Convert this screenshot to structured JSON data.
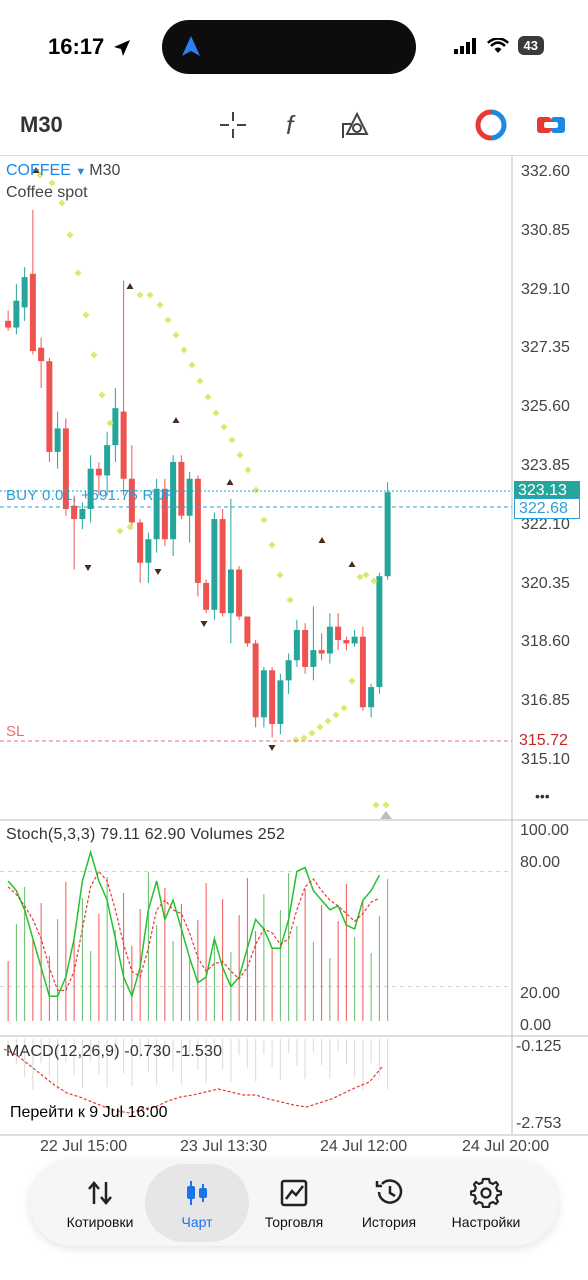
{
  "status": {
    "time": "16:17",
    "battery": "43"
  },
  "toolbar": {
    "timeframe": "M30"
  },
  "chart": {
    "symbol": "COFFEE",
    "timeframe": "M30",
    "description": "Coffee spot",
    "price_labels": [
      "332.60",
      "330.85",
      "329.10",
      "327.35",
      "325.60",
      "323.85",
      "322.10",
      "320.35",
      "318.60",
      "316.85",
      "315.10"
    ],
    "current_price": "323.13",
    "bid_price": "322.68",
    "sl_price": "315.72",
    "position_label": "BUY 0.01, +691.75 RUR",
    "sl_label": "SL",
    "more": "•••",
    "colors": {
      "bull": "#26a69a",
      "bear": "#ef5350",
      "psar": "#d7ec6b",
      "price_line": "#2a9fd6",
      "sl": "#e57373"
    }
  },
  "stoch": {
    "label": "Stoch(5,3,3) 79.11 62.90 Volumes 252",
    "levels": [
      "100.00",
      "80.00",
      "20.00",
      "0.00"
    ]
  },
  "macd": {
    "label": "MACD(12,26,9) -0.730 -1.530",
    "levels": [
      "-0.125",
      "-2.753"
    ]
  },
  "goto": "Перейти к 9 Jul 16:00",
  "x_labels": [
    "22 Jul 15:00",
    "23 Jul 13:30",
    "24 Jul 12:00",
    "24 Jul 20:00"
  ],
  "chart_data": {
    "type": "candlestick",
    "price_axis": [
      315.1,
      332.6
    ],
    "candles": [
      [
        328.2,
        328.5,
        327.9,
        328.0
      ],
      [
        328.0,
        329.3,
        327.8,
        328.8
      ],
      [
        328.6,
        329.8,
        328.2,
        329.5
      ],
      [
        329.6,
        331.5,
        327.2,
        327.3
      ],
      [
        327.4,
        327.7,
        326.2,
        327.0
      ],
      [
        327.0,
        327.1,
        324.0,
        324.3
      ],
      [
        324.3,
        325.5,
        323.8,
        325.0
      ],
      [
        325.0,
        325.3,
        322.4,
        322.6
      ],
      [
        322.7,
        323.0,
        320.8,
        322.3
      ],
      [
        322.3,
        322.8,
        322.0,
        322.6
      ],
      [
        322.6,
        324.2,
        322.2,
        323.8
      ],
      [
        323.8,
        324.0,
        323.0,
        323.6
      ],
      [
        323.6,
        324.9,
        323.0,
        324.5
      ],
      [
        324.5,
        326.2,
        324.0,
        325.6
      ],
      [
        325.5,
        329.4,
        323.0,
        323.5
      ],
      [
        323.5,
        324.5,
        322.0,
        322.2
      ],
      [
        322.2,
        322.3,
        320.4,
        321.0
      ],
      [
        321.0,
        321.9,
        320.4,
        321.7
      ],
      [
        321.7,
        323.5,
        321.3,
        323.2
      ],
      [
        323.2,
        323.5,
        321.5,
        321.7
      ],
      [
        321.7,
        324.2,
        321.2,
        324.0
      ],
      [
        324.0,
        324.2,
        322.3,
        322.4
      ],
      [
        322.4,
        323.7,
        321.6,
        323.5
      ],
      [
        323.5,
        323.6,
        320.0,
        320.4
      ],
      [
        320.4,
        320.5,
        319.5,
        319.6
      ],
      [
        319.6,
        322.5,
        319.3,
        322.3
      ],
      [
        322.3,
        322.6,
        319.4,
        319.5
      ],
      [
        319.5,
        322.9,
        318.6,
        320.8
      ],
      [
        320.8,
        320.9,
        319.3,
        319.4
      ],
      [
        319.4,
        319.4,
        318.5,
        318.6
      ],
      [
        318.6,
        318.7,
        316.1,
        316.4
      ],
      [
        316.4,
        317.9,
        316.1,
        317.8
      ],
      [
        317.8,
        317.9,
        315.8,
        316.2
      ],
      [
        316.2,
        317.7,
        315.9,
        317.5
      ],
      [
        317.5,
        318.3,
        317.1,
        318.1
      ],
      [
        318.1,
        319.3,
        317.9,
        319.0
      ],
      [
        319.0,
        319.2,
        317.7,
        317.9
      ],
      [
        317.9,
        319.7,
        317.5,
        318.4
      ],
      [
        318.4,
        318.9,
        318.1,
        318.3
      ],
      [
        318.3,
        319.5,
        318.0,
        319.1
      ],
      [
        319.1,
        319.5,
        318.4,
        318.7
      ],
      [
        318.7,
        318.8,
        318.4,
        318.6
      ],
      [
        318.6,
        319.0,
        318.5,
        318.8
      ],
      [
        318.8,
        319.1,
        316.6,
        316.7
      ],
      [
        316.7,
        317.4,
        316.4,
        317.3
      ],
      [
        317.3,
        320.7,
        317.1,
        320.6
      ],
      [
        320.6,
        323.4,
        320.5,
        323.1
      ]
    ],
    "macd_line": [
      -1.05,
      -1.15,
      -1.2,
      -1.25,
      -1.35,
      -1.45,
      -1.5,
      -1.55,
      -1.65,
      -1.7,
      -1.75,
      -1.72,
      -1.68,
      -1.6,
      -1.55,
      -1.52,
      -1.5,
      -1.48,
      -1.5,
      -1.55,
      -1.55,
      -1.58,
      -1.6,
      -1.63,
      -1.67,
      -1.65,
      -1.6,
      -1.55,
      -1.5,
      -1.45,
      -0.73
    ],
    "macd_signal": [
      -1.53
    ]
  }
}
